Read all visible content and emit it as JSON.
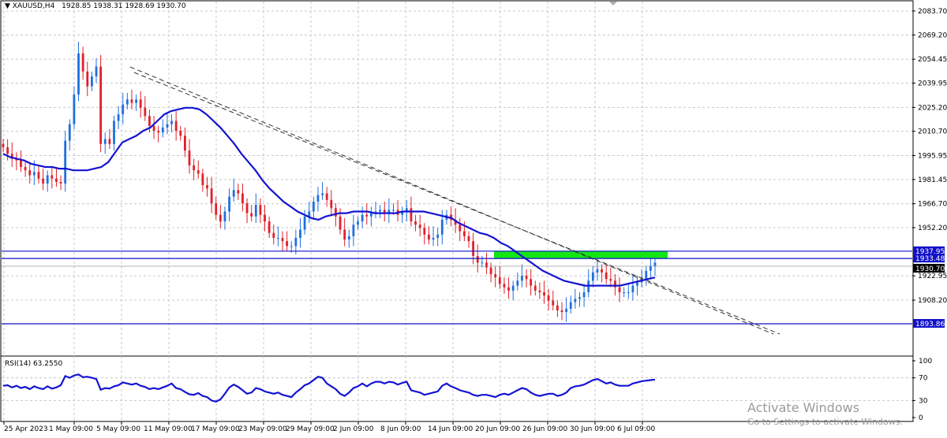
{
  "header": {
    "symbol": "XAUUSD,H4",
    "ohlc": "1928.85 1938.31 1928.69 1930.70"
  },
  "indicator": {
    "label": "RSI(14) 63.2550"
  },
  "levels": {
    "upper": "1937.95",
    "mid": "1933.48",
    "current": "1930.70",
    "lower": "1893.86"
  },
  "colors": {
    "bull": "#1f6fe0",
    "bear": "#e0202a",
    "ma": "#1414d2",
    "level": "#1010c8",
    "zone": "#14e614",
    "grid": "#c8c8c8"
  },
  "chart_data": [
    {
      "type": "candlestick",
      "title": "XAUUSD,H4",
      "ylim": [
        1880,
        2090
      ],
      "y_ticks": [
        "2083.70",
        "2069.20",
        "2054.45",
        "2039.95",
        "2025.20",
        "2010.70",
        "1995.95",
        "1981.45",
        "1966.70",
        "1952.20",
        "1922.95",
        "1908.20"
      ],
      "x_ticks": [
        "25 Apr 2023",
        "1 May 09:00",
        "5 May 09:00",
        "11 May 09:00",
        "17 May 09:00",
        "23 May 09:00",
        "29 May 09:00",
        "2 Jun 09:00",
        "8 Jun 09:00",
        "14 Jun 09:00",
        "20 Jun 09:00",
        "26 Jun 09:00",
        "30 Jun 09:00",
        "6 Jul 09:00"
      ],
      "close_series": [
        2001,
        1997,
        1994,
        1993,
        1989,
        1987,
        1984,
        1986,
        1982,
        1979,
        1984,
        1982,
        1980,
        1979,
        2005,
        2015,
        2033,
        2058,
        2047,
        2038,
        2044,
        2050,
        2003,
        2006,
        2003,
        2017,
        2021,
        2027,
        2030,
        2028,
        2030,
        2025,
        2020,
        2014,
        2011,
        2010,
        2013,
        2015,
        2017,
        2011,
        2008,
        1999,
        1990,
        1987,
        1985,
        1978,
        1976,
        1967,
        1960,
        1956,
        1962,
        1971,
        1975,
        1973,
        1967,
        1961,
        1959,
        1966,
        1960,
        1956,
        1949,
        1946,
        1946,
        1944,
        1941,
        1941,
        1946,
        1951,
        1959,
        1962,
        1968,
        1972,
        1973,
        1969,
        1964,
        1959,
        1951,
        1945,
        1947,
        1954,
        1956,
        1960,
        1959,
        1961,
        1962,
        1963,
        1961,
        1963,
        1963,
        1960,
        1962,
        1964,
        1956,
        1954,
        1952,
        1948,
        1945,
        1946,
        1948,
        1957,
        1960,
        1957,
        1954,
        1950,
        1947,
        1944,
        1935,
        1931,
        1931,
        1928,
        1924,
        1922,
        1918,
        1916,
        1914,
        1917,
        1920,
        1923,
        1921,
        1917,
        1914,
        1913,
        1911,
        1908,
        1905,
        1902,
        1901,
        1903,
        1907,
        1909,
        1910,
        1913,
        1920,
        1925,
        1927,
        1925,
        1921,
        1920,
        1916,
        1913,
        1913,
        1913,
        1917,
        1919,
        1921,
        1926,
        1929,
        1931
      ],
      "ma_series": [
        1997,
        1995,
        1994,
        1993,
        1991,
        1990,
        1989,
        1989,
        1988,
        1988,
        1987,
        1987,
        1987,
        1988,
        1989,
        1992,
        1998,
        2004,
        2006,
        2008,
        2011,
        2013,
        2017,
        2021,
        2023,
        2024,
        2025,
        2025,
        2024,
        2021,
        2017,
        2013,
        2008,
        2003,
        1997,
        1992,
        1987,
        1981,
        1976,
        1972,
        1968,
        1965,
        1962,
        1960,
        1958,
        1957,
        1959,
        1960,
        1961,
        1961,
        1962,
        1962,
        1962,
        1961,
        1961,
        1961,
        1961,
        1962,
        1962,
        1962,
        1962,
        1961,
        1960,
        1959,
        1958,
        1955,
        1953,
        1951,
        1949,
        1948,
        1946,
        1943,
        1941,
        1938,
        1935,
        1932,
        1929,
        1926,
        1924,
        1922,
        1920,
        1919,
        1918,
        1917,
        1917,
        1917,
        1917,
        1917,
        1917,
        1918,
        1919,
        1920,
        1921,
        1922
      ],
      "ma_name": "",
      "levels": [
        1937.95,
        1933.48,
        1893.86
      ],
      "zone": [
        1933.48,
        1937.95
      ],
      "trendline": {
        "from": [
          "27 Apr",
          2043
        ],
        "to": [
          "9 Jul",
          1887
        ]
      }
    },
    {
      "type": "line",
      "title": "RSI(14) 63.2550",
      "ylim": [
        0,
        100
      ],
      "y_ticks": [
        "100",
        "70",
        "30",
        "0"
      ],
      "values": [
        56,
        57,
        53,
        56,
        52,
        54,
        50,
        55,
        52,
        50,
        55,
        51,
        53,
        57,
        73,
        70,
        74,
        76,
        71,
        72,
        70,
        68,
        49,
        52,
        51,
        55,
        57,
        62,
        60,
        58,
        60,
        56,
        54,
        50,
        52,
        50,
        53,
        56,
        60,
        52,
        50,
        45,
        41,
        40,
        43,
        38,
        36,
        30,
        28,
        32,
        42,
        53,
        58,
        54,
        48,
        42,
        44,
        52,
        50,
        46,
        44,
        42,
        44,
        40,
        38,
        36,
        44,
        50,
        57,
        60,
        66,
        72,
        70,
        60,
        55,
        50,
        42,
        38,
        44,
        52,
        55,
        60,
        55,
        60,
        63,
        63,
        60,
        63,
        62,
        58,
        61,
        63,
        48,
        46,
        44,
        40,
        42,
        44,
        46,
        56,
        60,
        55,
        52,
        48,
        46,
        44,
        40,
        38,
        40,
        40,
        38,
        36,
        40,
        42,
        40,
        44,
        48,
        52,
        50,
        44,
        40,
        38,
        40,
        42,
        42,
        38,
        40,
        44,
        52,
        55,
        56,
        58,
        62,
        66,
        68,
        64,
        60,
        62,
        58,
        56,
        56,
        56,
        60,
        62,
        64,
        65,
        66,
        67
      ]
    }
  ]
}
